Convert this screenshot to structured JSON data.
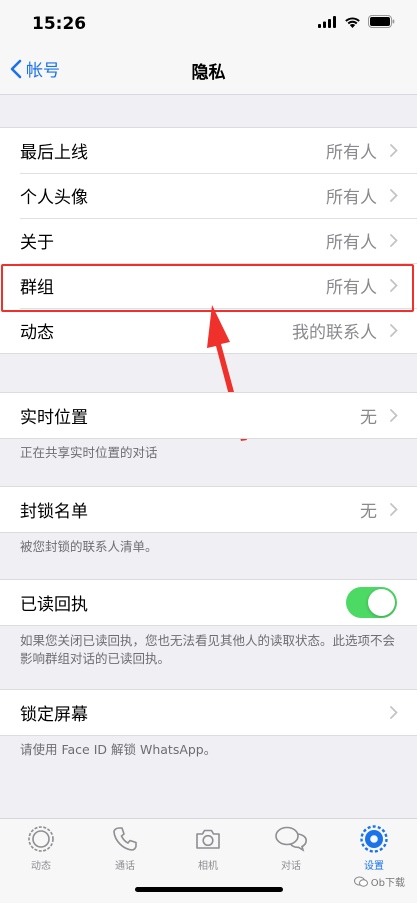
{
  "status": {
    "time": "15:26"
  },
  "nav": {
    "back_label": "帐号",
    "title": "隐私"
  },
  "section1": {
    "rows": [
      {
        "label": "最后上线",
        "value": "所有人"
      },
      {
        "label": "个人头像",
        "value": "所有人"
      },
      {
        "label": "关于",
        "value": "所有人"
      },
      {
        "label": "群组",
        "value": "所有人"
      },
      {
        "label": "动态",
        "value": "我的联系人"
      }
    ]
  },
  "live_location": {
    "label": "实时位置",
    "value": "无",
    "note": "正在共享实时位置的对话"
  },
  "blocked": {
    "label": "封锁名单",
    "value": "无",
    "note": "被您封锁的联系人清单。"
  },
  "read_receipts": {
    "label": "已读回执",
    "on": true,
    "note": "如果您关闭已读回执，您也无法看见其他人的读取状态。此选项不会影响群组对话的已读回执。"
  },
  "screen_lock": {
    "label": "锁定屏幕",
    "note": "请使用 Face ID 解锁 WhatsApp。"
  },
  "tabs": [
    {
      "label": "动态",
      "icon": "status-icon",
      "active": false
    },
    {
      "label": "通话",
      "icon": "phone-icon",
      "active": false
    },
    {
      "label": "相机",
      "icon": "camera-icon",
      "active": false
    },
    {
      "label": "对话",
      "icon": "chats-icon",
      "active": false
    },
    {
      "label": "设置",
      "icon": "settings-gear-icon",
      "active": true
    }
  ],
  "watermark": "Ob下载",
  "colors": {
    "accent": "#1a73e8",
    "toggle_on": "#4cd964",
    "highlight": "#f0302a",
    "arrow": "#f0302a"
  }
}
